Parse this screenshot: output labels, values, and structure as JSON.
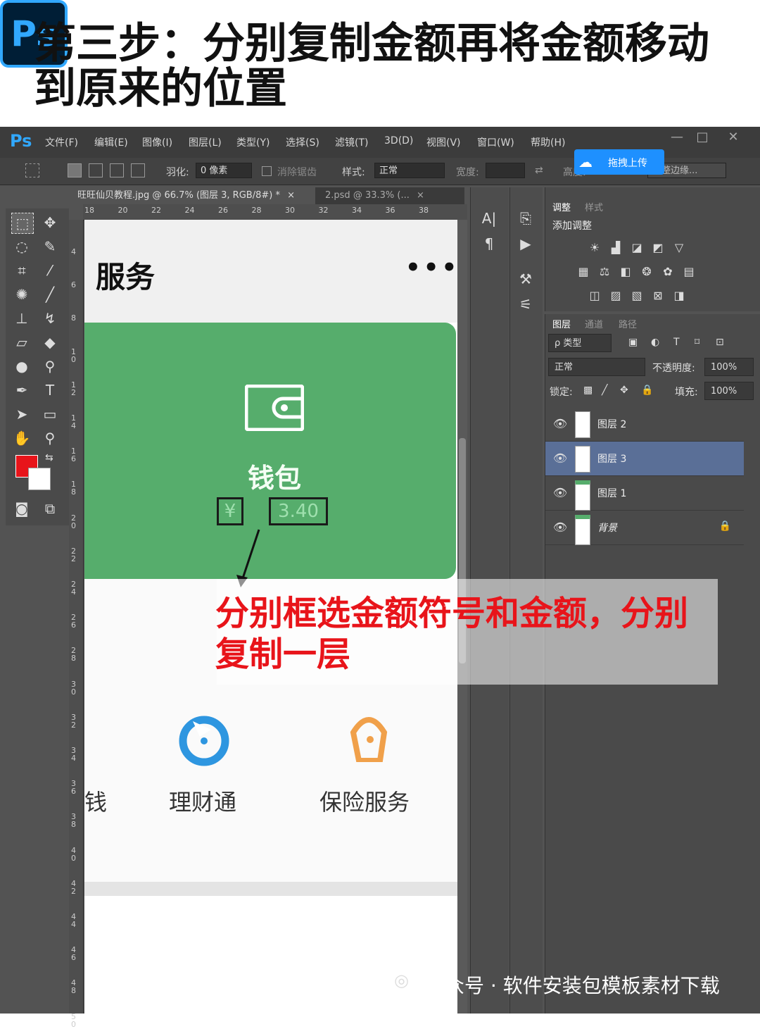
{
  "header": {
    "badge": "Ps",
    "title": "第三步：分别复制金额再将金额移动到原来的位置"
  },
  "menubar": {
    "logo": "Ps",
    "items": [
      "文件(F)",
      "编辑(E)",
      "图像(I)",
      "图层(L)",
      "类型(Y)",
      "选择(S)",
      "滤镜(T)",
      "3D(D)",
      "视图(V)",
      "窗口(W)",
      "帮助(H)"
    ],
    "window_controls": [
      "—",
      "□",
      "✕"
    ]
  },
  "options": {
    "feather_label": "羽化:",
    "feather_value": "0 像素",
    "antialias_label": "消除锯齿",
    "style_label": "样式:",
    "style_value": "正常",
    "width_label": "宽度:",
    "height_label": "高度:",
    "refine_edge": "调整边缘..."
  },
  "upload": {
    "label": "拖拽上传"
  },
  "tabs": [
    {
      "label": "旺旺仙贝教程.jpg @ 66.7% (图层 3, RGB/8#) *",
      "close": "×"
    },
    {
      "label": "2.psd @ 33.3% (...",
      "close": "×"
    }
  ],
  "ruler": {
    "h_ticks": [
      "18",
      "20",
      "22",
      "24",
      "26",
      "28",
      "30",
      "32",
      "34",
      "36",
      "38"
    ],
    "v_ticks": [
      "4",
      "6",
      "8",
      "10",
      "12",
      "14",
      "16",
      "18",
      "20",
      "22",
      "24",
      "26",
      "28",
      "30",
      "32",
      "34",
      "36",
      "38",
      "40",
      "42",
      "44",
      "46",
      "48",
      "50"
    ]
  },
  "canvas": {
    "page_title": "服务",
    "more": "•••",
    "wallet_label": "钱包",
    "yen": "¥",
    "amount": "3.40",
    "services": [
      {
        "label": "钱",
        "icon": ""
      },
      {
        "label": "理财通",
        "icon": "licaitong-icon"
      },
      {
        "label": "保险服务",
        "icon": "insurance-icon"
      }
    ]
  },
  "adjust_panel": {
    "tabs": [
      "调整",
      "样式"
    ],
    "title": "添加调整"
  },
  "layers_panel": {
    "tabs": [
      "图层",
      "通道",
      "路径"
    ],
    "filter_label": "ρ 类型",
    "blend_mode": "正常",
    "opacity_label": "不透明度:",
    "opacity_value": "100%",
    "lock_label": "锁定:",
    "fill_label": "填充:",
    "fill_value": "100%",
    "layers": [
      {
        "name": "图层 2",
        "active": false,
        "locked": false
      },
      {
        "name": "图层 3",
        "active": true,
        "locked": false
      },
      {
        "name": "图层 1",
        "active": false,
        "locked": false
      },
      {
        "name": "背景",
        "active": false,
        "locked": true
      }
    ]
  },
  "annotation": {
    "text": "分别框选金额符号和金额，分别复制一层"
  },
  "watermark": {
    "text": "公众号 · 软件安装包模板素材下载"
  },
  "colors": {
    "ps_blue": "#31a8ff",
    "card_green": "#56ad6c",
    "annotation_red": "#e8141a",
    "active_layer": "#5a6f97",
    "foreground_swatch": "#e8141a",
    "background_swatch": "#ffffff"
  }
}
